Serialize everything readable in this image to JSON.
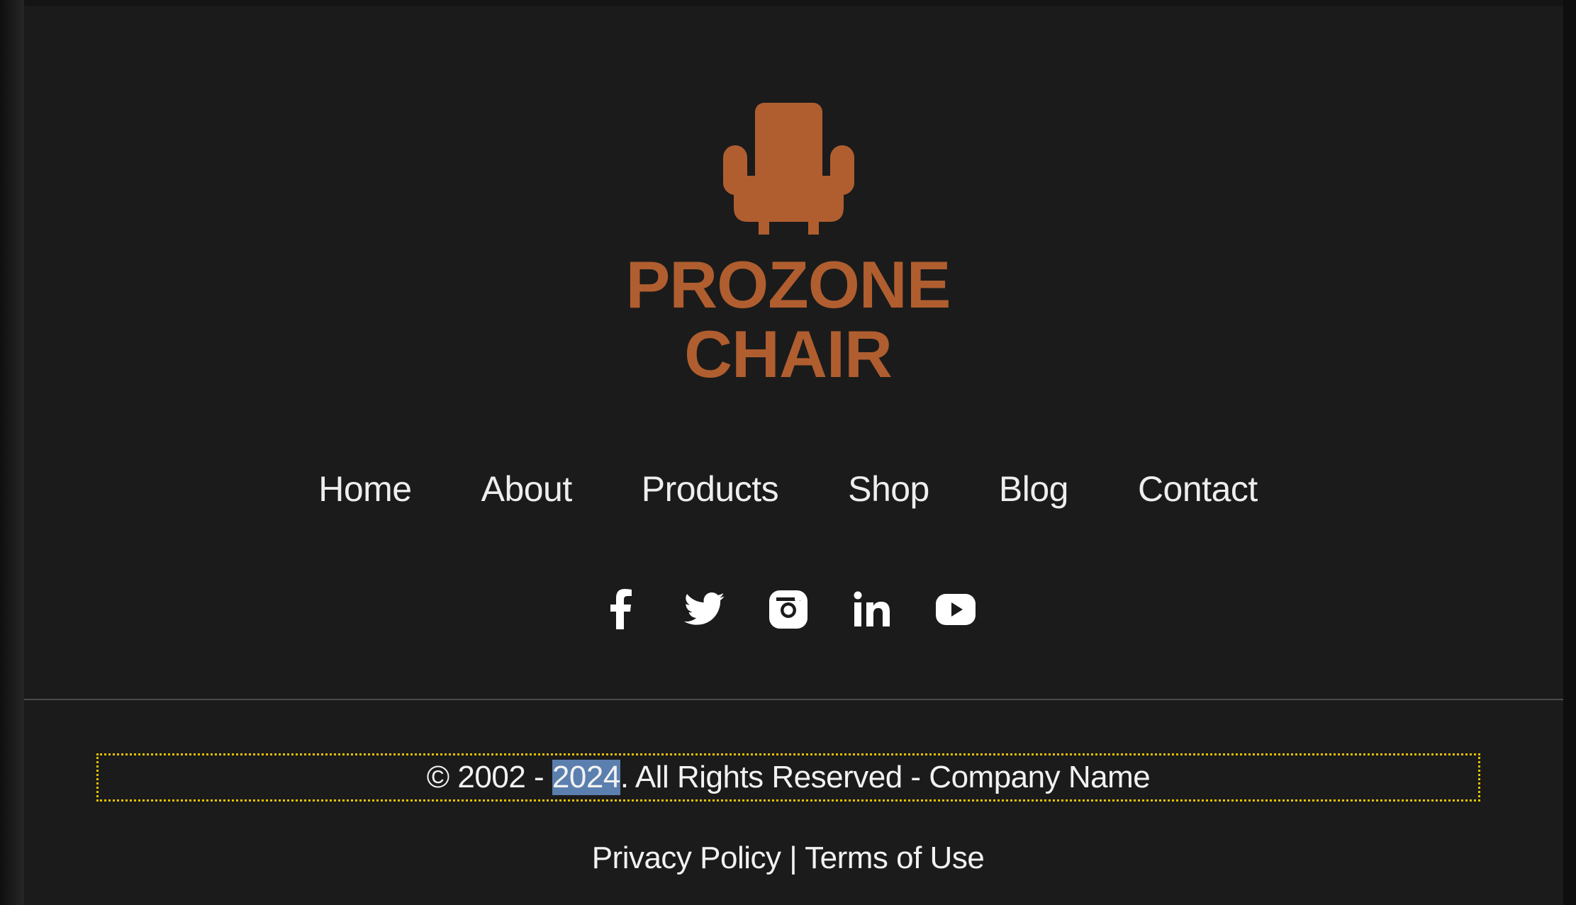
{
  "brand": {
    "line1": "PROZONE",
    "line2": "CHAIR",
    "color": "#b05e2f",
    "logo_icon": "armchair-icon"
  },
  "nav": {
    "items": [
      {
        "label": "Home"
      },
      {
        "label": "About"
      },
      {
        "label": "Products"
      },
      {
        "label": "Shop"
      },
      {
        "label": "Blog"
      },
      {
        "label": "Contact"
      }
    ]
  },
  "social": {
    "icons": [
      "facebook-icon",
      "twitter-icon",
      "instagram-icon",
      "linkedin-icon",
      "youtube-icon"
    ]
  },
  "footer": {
    "copyright_prefix": "© 2002 - ",
    "copyright_year": "2024",
    "copyright_suffix": ". All Rights Reserved - Company Name",
    "privacy_label": "Privacy Policy",
    "separator": " | ",
    "terms_label": "Terms of Use",
    "focus_outline_color": "#e5c100",
    "selection_color": "#5b7fae"
  }
}
